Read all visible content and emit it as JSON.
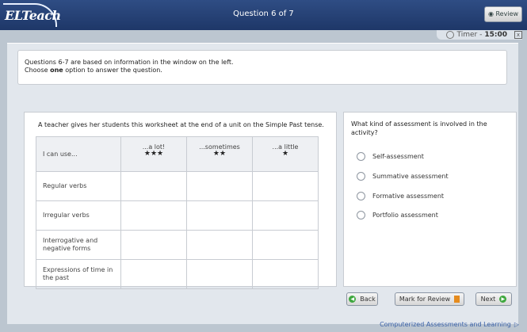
{
  "header": {
    "logo": "ELTeach",
    "question_counter": "Question 6 of 7",
    "review_label": "Review",
    "timer_label": "Timer -",
    "timer_value": "15:00",
    "close_glyph": "x"
  },
  "instructions": {
    "line1": "Questions 6-7 are based on information in the window on the left.",
    "line2_prefix": "Choose ",
    "line2_bold": "one",
    "line2_suffix": " option to answer the question."
  },
  "stimulus": {
    "intro": "A teacher gives her students this worksheet at the end of a unit on the Simple Past tense.",
    "table": {
      "headers": [
        {
          "label": "I can use...",
          "stars": ""
        },
        {
          "label": "...a lot!",
          "stars": "★★★"
        },
        {
          "label": "...sometimes",
          "stars": "★★"
        },
        {
          "label": "...a little",
          "stars": "★"
        }
      ],
      "rows": [
        "Regular verbs",
        "Irregular verbs",
        "Interrogative and negative forms",
        "Expressions of time in the past"
      ]
    }
  },
  "question": {
    "text": "What kind of assessment is involved in the activity?",
    "options": [
      "Self-assessment",
      "Summative assessment",
      "Formative assessment",
      "Portfolio assessment"
    ]
  },
  "nav": {
    "back_label": "Back",
    "mark_label": "Mark for Review",
    "next_label": "Next"
  },
  "footer": {
    "text": "Computerized Assessments and Learning"
  },
  "colors": {
    "header": "#1e3768",
    "accent_green": "#3fa83f",
    "flag_orange": "#e58b1e",
    "footer_blue": "#3b62a8"
  }
}
